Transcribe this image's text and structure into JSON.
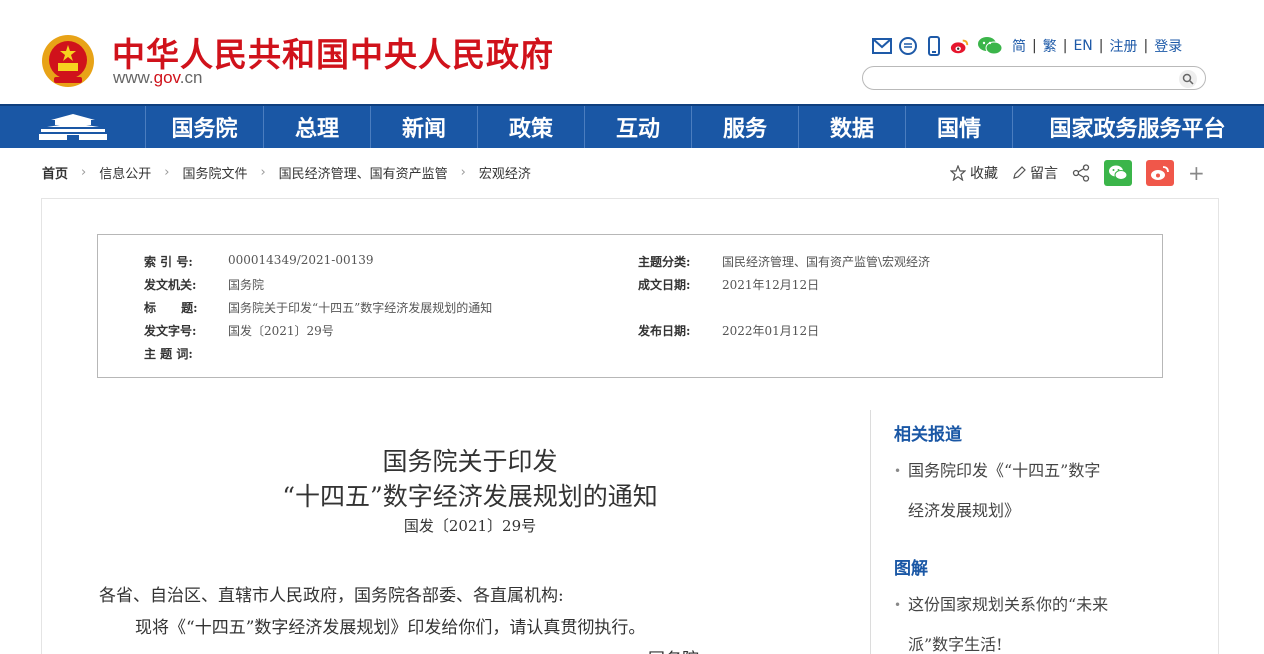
{
  "header": {
    "site_title": "中华人民共和国中央人民政府",
    "site_url_prefix": "www.",
    "site_url_brand": "gov",
    "site_url_suffix": ".cn",
    "tool_icons": [
      "mail-icon",
      "message-icon",
      "mobile-icon",
      "weibo-icon",
      "wechat-icon"
    ],
    "lang_links": [
      "简",
      "繁",
      "EN",
      "注册",
      "登录"
    ],
    "search_placeholder": ""
  },
  "nav": {
    "items": [
      {
        "label": "国务院",
        "width": 118
      },
      {
        "label": "总理",
        "width": 107
      },
      {
        "label": "新闻",
        "width": 107
      },
      {
        "label": "政策",
        "width": 107
      },
      {
        "label": "互动",
        "width": 107
      },
      {
        "label": "服务",
        "width": 107
      },
      {
        "label": "数据",
        "width": 107
      },
      {
        "label": "国情",
        "width": 107
      },
      {
        "label": "国家政务服务平台",
        "width": 250
      }
    ]
  },
  "breadcrumb": [
    "首页",
    "信息公开",
    "国务院文件",
    "国民经济管理、国有资产监管",
    "宏观经济"
  ],
  "share": {
    "favorite_label": "收藏",
    "comment_label": "留言",
    "plus_label": "+"
  },
  "info": {
    "index_label": "索 引 号:",
    "index_value": "000014349/2021-00139",
    "topic_label": "主题分类:",
    "topic_value": "国民经济管理、国有资产监管\\宏观经济",
    "issuer_label": "发文机关:",
    "issuer_value": "国务院",
    "written_label": "成文日期:",
    "written_value": "2021年12月12日",
    "title_label": "标      题:",
    "title_value": "国务院关于印发“十四五”数字经济发展规划的通知",
    "docno_label": "发文字号:",
    "docno_value": "国发〔2021〕29号",
    "published_label": "发布日期:",
    "published_value": "2022年01月12日",
    "keywords_label": "主 题 词:",
    "keywords_value": ""
  },
  "article": {
    "title_line1": "国务院关于印发",
    "title_line2": "“十四五”数字经济发展规划的通知",
    "doc_no": "国发〔2021〕29号",
    "salutation": "各省、自治区、直辖市人民政府，国务院各部委、各直属机构:",
    "body_line1": "现将《“十四五”数字经济发展规划》印发给你们，请认真贯彻执行。",
    "signature_partial": "国务院"
  },
  "sidebar": {
    "related_heading": "相关报道",
    "related_item_line1": "国务院印发《“十四五”数字",
    "related_item_line2": "经济发展规划》",
    "graphic_heading": "图解",
    "graphic_item_line1": "这份国家规划关系你的“未来",
    "graphic_item_line2": "派”数字生活!"
  },
  "colors": {
    "brand_red": "#d0121b",
    "nav_blue": "#1a57a5",
    "link_blue": "#1e5aa8"
  }
}
